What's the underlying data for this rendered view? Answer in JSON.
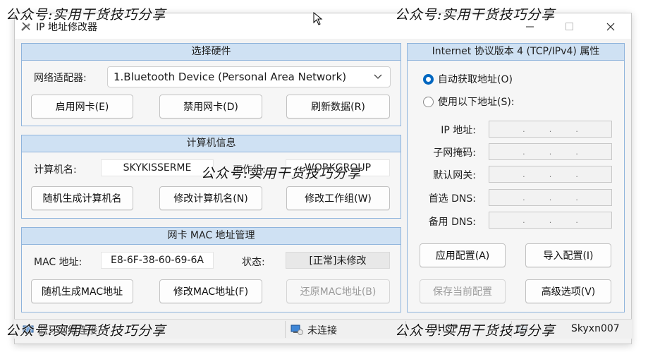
{
  "window": {
    "title": "IP 地址修改器",
    "controls": {
      "minimize": "—",
      "maximize": "☐",
      "close": "✕"
    }
  },
  "hardware": {
    "title": "选择硬件",
    "adapter_label": "网络适配器:",
    "adapter_value": "1.Bluetooth Device (Personal Area Network)",
    "buttons": {
      "enable": "启用网卡(E)",
      "disable": "禁用网卡(D)",
      "refresh": "刷新数据(R)"
    }
  },
  "computer": {
    "title": "计算机信息",
    "name_label": "计算机名:",
    "name_value": "SKYKISSERME",
    "workgroup_label": "工作组:",
    "workgroup_value": "WORKGROUP",
    "buttons": {
      "random_name": "随机生成计算机名",
      "modify_name": "修改计算机名(N)",
      "modify_workgroup": "修改工作组(W)"
    }
  },
  "mac": {
    "title": "网卡 MAC 地址管理",
    "mac_label": "MAC 地址:",
    "mac_value": "E8-6F-38-60-69-6A",
    "status_label": "状态:",
    "status_value": "[正常]未修改",
    "buttons": {
      "random_mac": "随机生成MAC地址",
      "modify_mac": "修改MAC地址(F)",
      "restore_mac": "还原MAC地址(B)"
    }
  },
  "ipv4": {
    "title": "Internet 协议版本 4 (TCP/IPv4) 属性",
    "auto_label": "自动获取地址(O)",
    "manual_label": "使用以下地址(S):",
    "selected": "auto",
    "fields": [
      {
        "label": "IP 地址:"
      },
      {
        "label": "子网掩码:"
      },
      {
        "label": "默认网关:"
      },
      {
        "label": "首选 DNS:"
      },
      {
        "label": "备用 DNS:"
      }
    ],
    "buttons": {
      "apply": "应用配置(A)",
      "import": "导入配置(I)",
      "save": "保存当前配置",
      "advanced": "高级选项(V)"
    }
  },
  "statusbar": {
    "adapter": "蓝牙网络连接",
    "connection": "未连接",
    "dhcp": "DHCP",
    "user": "Skyxn007"
  },
  "watermark": "公众号:实用干货技巧分享",
  "colors": {
    "group_border": "#8fb4dc",
    "group_header": "#cfe1f3",
    "accent": "#0067c0"
  }
}
